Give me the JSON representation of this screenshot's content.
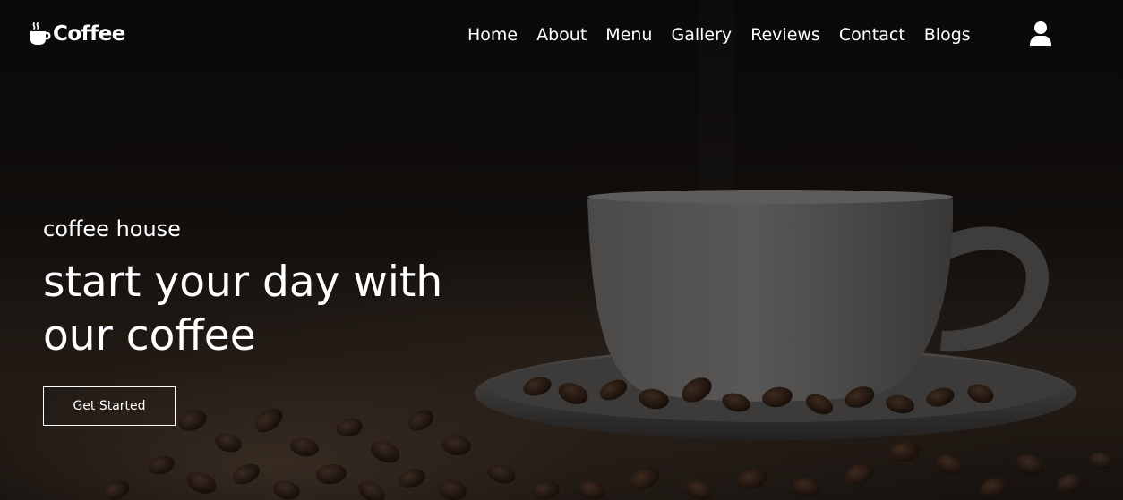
{
  "navbar": {
    "logo_text": "Coffee",
    "logo_icon": "coffee-cup-icon",
    "links": [
      {
        "label": "Home"
      },
      {
        "label": "About"
      },
      {
        "label": "Menu"
      },
      {
        "label": "Gallery"
      },
      {
        "label": "Reviews"
      },
      {
        "label": "Contact"
      },
      {
        "label": "Blogs"
      }
    ],
    "user_icon": "user-icon"
  },
  "hero": {
    "eyebrow": "coffee house",
    "headline_line1": "start your day with",
    "headline_line2": "our coffee",
    "cta_label": "Get Started",
    "background_image": "coffee-cup-on-saucer-with-beans"
  },
  "colors": {
    "text": "#ffffff",
    "overlay": "#0b0908"
  }
}
